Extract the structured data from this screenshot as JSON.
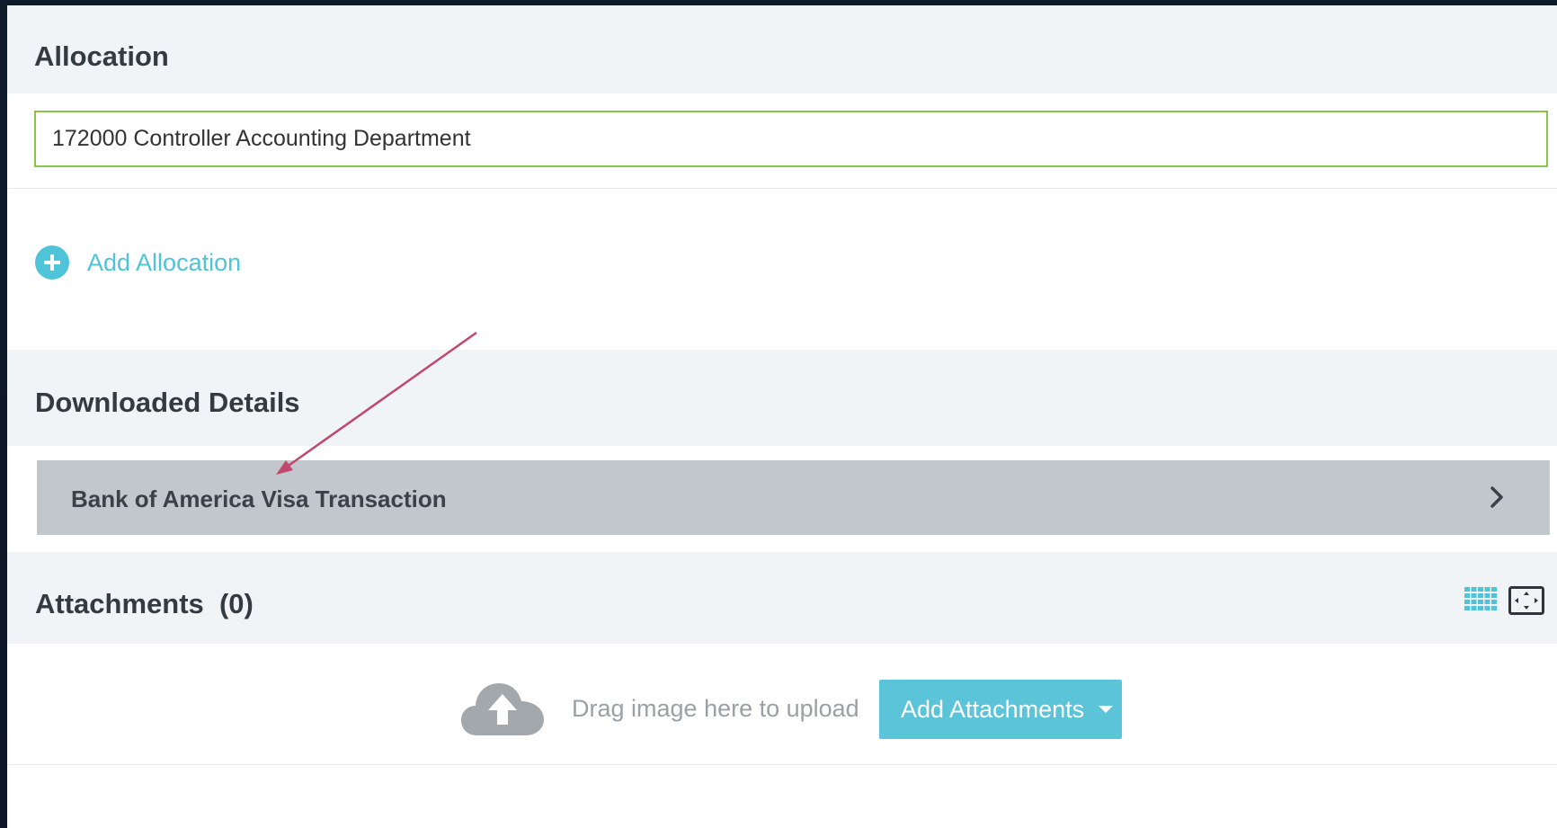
{
  "allocation": {
    "title": "Allocation",
    "field_value": "172000 Controller Accounting Department",
    "add_label": "Add Allocation"
  },
  "downloaded_details": {
    "title": "Downloaded Details",
    "row_label": "Bank of America Visa Transaction"
  },
  "attachments": {
    "title": "Attachments  (0)",
    "drag_text": "Drag image here to upload",
    "add_button_label": "Add Attachments"
  },
  "colors": {
    "accent": "#5bc4d9",
    "field_border": "#8cc44a",
    "annotation_arrow": "#c2476e",
    "row_background": "#c1c7cb"
  },
  "icons": [
    "plus-circle-icon",
    "chevron-right-icon",
    "grid-view-icon",
    "fullscreen-icon",
    "cloud-upload-icon",
    "caret-down-icon"
  ]
}
